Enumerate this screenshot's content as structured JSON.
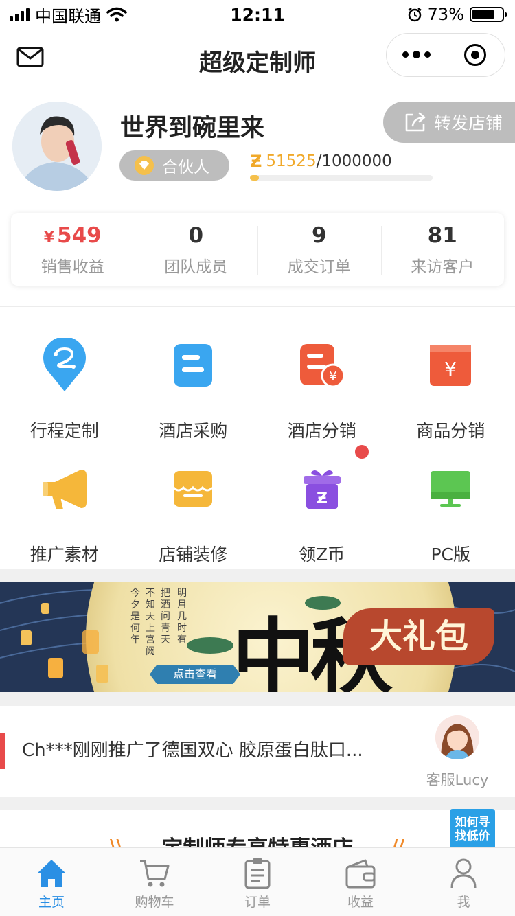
{
  "status_bar": {
    "carrier": "中国联通",
    "time": "12:11",
    "battery": "73%",
    "battery_level": 0.73
  },
  "nav": {
    "title": "超级定制师"
  },
  "profile": {
    "name": "世界到碗里来",
    "share_label": "转发店铺",
    "badge": "合伙人",
    "points_symbol": "Ƶ",
    "points_current": "51525",
    "points_total": "/1000000",
    "points_progress": 0.05
  },
  "stats": [
    {
      "currency": "¥",
      "value": "549",
      "label": "销售收益"
    },
    {
      "value": "0",
      "label": "团队成员"
    },
    {
      "value": "9",
      "label": "成交订单"
    },
    {
      "value": "81",
      "label": "来访客户"
    }
  ],
  "grid": [
    {
      "label": "行程定制",
      "icon": "route-pin-icon",
      "color": "#3aa6f0"
    },
    {
      "label": "酒店采购",
      "icon": "hotel-doc-icon",
      "color": "#3aa6f0"
    },
    {
      "label": "酒店分销",
      "icon": "hotel-yen-icon",
      "color": "#ee5b3b"
    },
    {
      "label": "商品分销",
      "icon": "yen-box-icon",
      "color": "#ee5b3b"
    },
    {
      "label": "推广素材",
      "icon": "megaphone-icon",
      "color": "#f5b73a"
    },
    {
      "label": "店铺装修",
      "icon": "shop-awning-icon",
      "color": "#f5b73a"
    },
    {
      "label": "领Z币",
      "icon": "gift-z-icon",
      "color": "#8a4fe0"
    },
    {
      "label": "PC版",
      "icon": "monitor-icon",
      "color": "#5cc652"
    }
  ],
  "banner": {
    "big_text": "中秋",
    "sub_text": "大礼包",
    "button": "点击查看",
    "poem_1": "明月几时有",
    "poem_2": "把酒问青天",
    "poem_3": "不知天上宫阙",
    "poem_4": "今夕是何年"
  },
  "notice": {
    "text": "Ch***刚刚推广了德国双心 胶原蛋白肽口...",
    "service_label": "客服Lucy"
  },
  "hotel_section": {
    "title": "定制师专享特惠酒店",
    "corner_tag": "如何寻找低价"
  },
  "tabs": [
    {
      "label": "主页",
      "icon": "home-icon",
      "active": true
    },
    {
      "label": "购物车",
      "icon": "cart-icon",
      "active": false
    },
    {
      "label": "订单",
      "icon": "order-list-icon",
      "active": false
    },
    {
      "label": "收益",
      "icon": "wallet-icon",
      "active": false
    },
    {
      "label": "我",
      "icon": "person-icon",
      "active": false
    }
  ]
}
